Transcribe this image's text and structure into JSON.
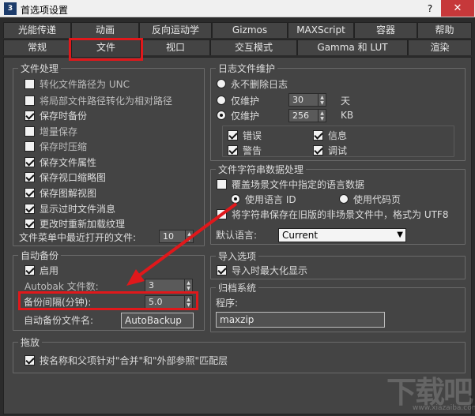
{
  "window": {
    "icon_text": "3",
    "title": "首选项设置",
    "help": "?",
    "close": "✕"
  },
  "tabs_row1": [
    "光能传递",
    "动画",
    "反向运动学",
    "Gizmos",
    "MAXScript",
    "容器",
    "帮助"
  ],
  "tabs_row2": [
    "常规",
    "文件",
    "视口",
    "交互模式",
    "Gamma 和 LUT",
    "渲染"
  ],
  "active_tab": "文件",
  "file_handling": {
    "title": "文件处理",
    "items": [
      {
        "label": "转化文件路径为 UNC",
        "checked": false
      },
      {
        "label": "将局部文件路径转化为相对路径",
        "checked": false
      },
      {
        "label": "保存时备份",
        "checked": true
      },
      {
        "label": "增量保存",
        "checked": false
      },
      {
        "label": "保存时压缩",
        "checked": false
      },
      {
        "label": "保存文件属性",
        "checked": true
      },
      {
        "label": "保存视口缩略图",
        "checked": true
      },
      {
        "label": "保存图解视图",
        "checked": true
      },
      {
        "label": "显示过时文件消息",
        "checked": true
      },
      {
        "label": "更改时重新加载纹理",
        "checked": true
      }
    ],
    "recent_files_label": "文件菜单中最近打开的文件:",
    "recent_files_value": "10"
  },
  "auto_backup": {
    "title": "自动备份",
    "enable_label": "启用",
    "enable_checked": true,
    "files_label": "Autobak 文件数:",
    "files_value": "3",
    "interval_label": "备份间隔(分钟):",
    "interval_value": "5.0",
    "filename_label": "自动备份文件名:",
    "filename_value": "AutoBackup"
  },
  "archive": {
    "title": "拖放",
    "item_label": "按名称和父项针对\"合并\"和\"外部参照\"匹配层",
    "item_checked": true
  },
  "log": {
    "title": "日志文件维护",
    "never_delete": "永不删除日志",
    "keep_days_label": "仅维护",
    "keep_days_value": "30",
    "keep_days_unit": "天",
    "keep_kb_label": "仅维护",
    "keep_kb_value": "256",
    "keep_kb_unit": "KB",
    "selected": "keep_kb",
    "error_label": "错误",
    "info_label": "信息",
    "warning_label": "警告",
    "debug_label": "调试"
  },
  "string_data": {
    "title": "文件字符串数据处理",
    "override_label": "覆盖场景文件中指定的语言数据",
    "use_lang_id": "使用语言 ID",
    "use_codepage": "使用代码页",
    "save_utf8_label": "将字符串保存在旧版的非场景文件中，格式为 UTF8",
    "default_lang_label": "默认语言:",
    "default_lang_value": "Current"
  },
  "import": {
    "title": "导入选项",
    "maximize_label": "导入时最大化显示"
  },
  "archive_system": {
    "title": "归档系统",
    "program_label": "程序:",
    "program_value": "maxzip"
  },
  "annotation_color": "#e0181b",
  "watermark": {
    "text": "下载吧",
    "sub": "www.xiazaiba.com"
  }
}
